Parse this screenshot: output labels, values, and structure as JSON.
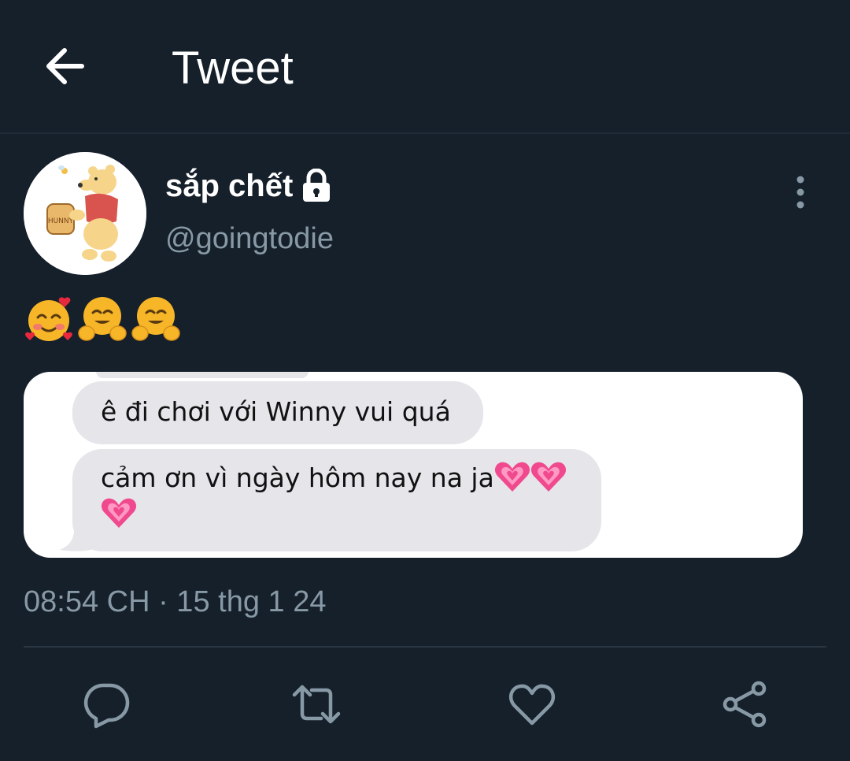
{
  "header": {
    "title": "Tweet",
    "back_icon": "arrow-left-icon"
  },
  "author": {
    "display_name": "sắp chết",
    "handle": "@goingtodie",
    "protected_icon": "lock-icon",
    "avatar_icon": "winnie-the-pooh-avatar",
    "avatar_jar_text": "HUNNY"
  },
  "tweet": {
    "emojis": [
      "smiling-face-with-hearts-emoji",
      "hugging-face-emoji",
      "hugging-face-emoji"
    ],
    "media": {
      "messages": [
        {
          "text": "ê đi chơi với Winny vui quá",
          "emojis": []
        },
        {
          "text": "cảm ơn vì ngày hôm nay na ja",
          "emojis": [
            "growing-heart-emoji",
            "growing-heart-emoji",
            "growing-heart-emoji"
          ]
        }
      ]
    },
    "timestamp": "08:54 CH · 15 thg 1 24"
  },
  "actions": [
    {
      "name": "reply",
      "icon": "reply-icon"
    },
    {
      "name": "retweet",
      "icon": "retweet-icon"
    },
    {
      "name": "like",
      "icon": "heart-icon"
    },
    {
      "name": "share",
      "icon": "share-icon"
    }
  ],
  "colors": {
    "background": "#15202b",
    "secondary_text": "#8899a6",
    "icon": "#8899a6",
    "bubble": "#e5e5ea",
    "divider": "#2a3743"
  }
}
